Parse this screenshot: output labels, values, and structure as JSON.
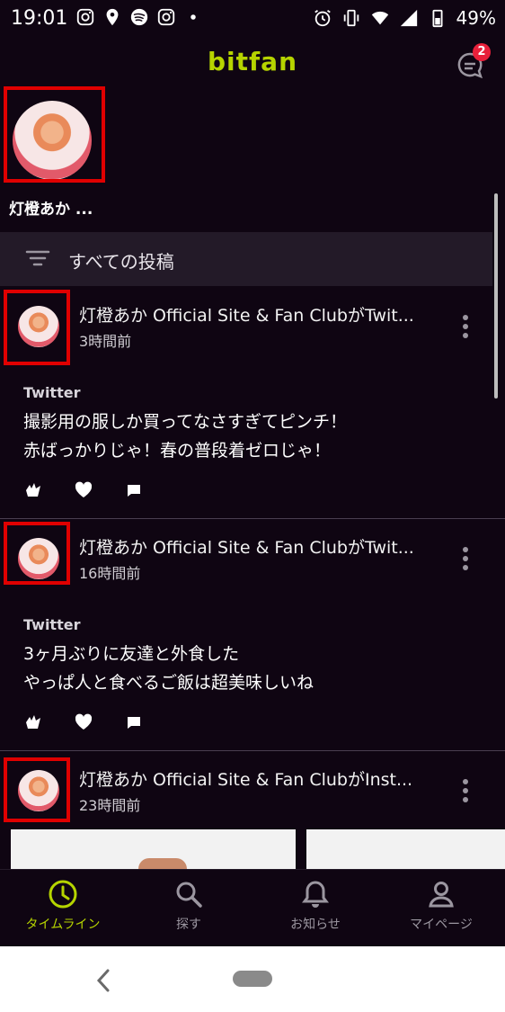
{
  "status_bar": {
    "time": "19:01",
    "battery": "49%"
  },
  "header": {
    "logo": "bitfan",
    "message_badge": "2"
  },
  "story": {
    "name": "灯橙あか ..."
  },
  "filter": {
    "label": "すべての投稿"
  },
  "posts": [
    {
      "title": "灯橙あか Official Site & Fan ClubがTwit...",
      "time": "3時間前",
      "source": "Twitter",
      "body_line1": "撮影用の服しか買ってなさすぎてピンチ！",
      "body_line2": "赤ばっかりじゃ！春の普段着ゼロじゃ！"
    },
    {
      "title": "灯橙あか Official Site & Fan ClubがTwit...",
      "time": "16時間前",
      "source": "Twitter",
      "body_line1": "3ヶ月ぶりに友達と外食した",
      "body_line2": "やっぱ人と食べるご飯は超美味しいね"
    },
    {
      "title": "灯橙あか Official Site & Fan ClubがInst...",
      "time": "23時間前"
    }
  ],
  "bottom_nav": {
    "items": [
      {
        "label": "タイムライン",
        "icon": "clock-icon",
        "active": true
      },
      {
        "label": "探す",
        "icon": "search-icon"
      },
      {
        "label": "お知らせ",
        "icon": "bell-icon"
      },
      {
        "label": "マイページ",
        "icon": "person-icon"
      }
    ]
  },
  "colors": {
    "accent": "#b6d400",
    "background": "#0f0512",
    "badge": "#e8203a",
    "highlight": "#e00000"
  }
}
